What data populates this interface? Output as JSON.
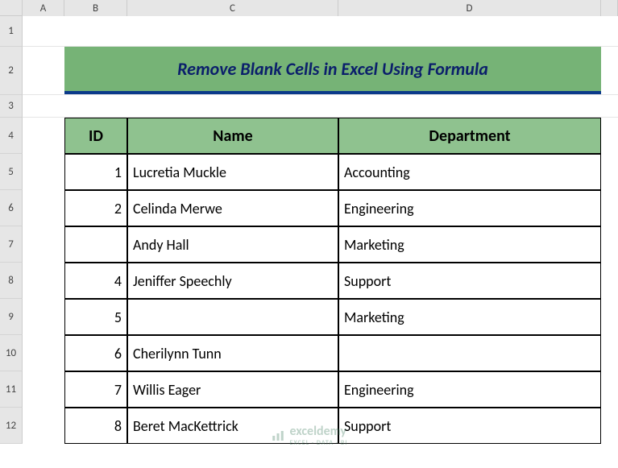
{
  "columns": {
    "A": "A",
    "B": "B",
    "C": "C",
    "D": "D",
    "E": ""
  },
  "rows": [
    "1",
    "2",
    "3",
    "4",
    "5",
    "6",
    "7",
    "8",
    "9",
    "10",
    "11",
    "12"
  ],
  "title": "Remove Blank Cells in Excel Using Formula",
  "table": {
    "headers": {
      "id": "ID",
      "name": "Name",
      "dept": "Department"
    },
    "data": [
      {
        "id": "1",
        "name": "Lucretia Muckle",
        "dept": "Accounting"
      },
      {
        "id": "2",
        "name": "Celinda Merwe",
        "dept": "Engineering"
      },
      {
        "id": "",
        "name": "Andy Hall",
        "dept": "Marketing"
      },
      {
        "id": "4",
        "name": "Jeniffer Speechly",
        "dept": "Support"
      },
      {
        "id": "5",
        "name": "",
        "dept": "Marketing"
      },
      {
        "id": "6",
        "name": "Cherilynn Tunn",
        "dept": ""
      },
      {
        "id": "7",
        "name": "Willis Eager",
        "dept": "Engineering"
      },
      {
        "id": "8",
        "name": "Beret MacKettrick",
        "dept": "Support"
      }
    ]
  },
  "watermark": {
    "brand": "exceldemy",
    "sub": "EXCEL · DATA · BI"
  }
}
